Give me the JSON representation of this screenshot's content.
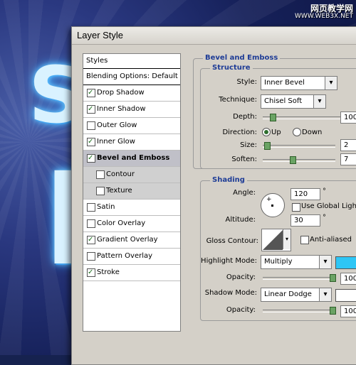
{
  "watermark": {
    "line1": "网页教学网",
    "line2": "WWW.WEB3X.NET"
  },
  "canvas": {
    "letter_top": "S",
    "letter_bottom": "I"
  },
  "dialog": {
    "title": "Layer Style"
  },
  "styles_panel": {
    "header": "Styles",
    "blending": "Blending Options: Default",
    "items": [
      {
        "label": "Drop Shadow",
        "checked": true
      },
      {
        "label": "Inner Shadow",
        "checked": true
      },
      {
        "label": "Outer Glow",
        "checked": false
      },
      {
        "label": "Inner Glow",
        "checked": true
      },
      {
        "label": "Bevel and Emboss",
        "checked": true,
        "selected": true
      },
      {
        "label": "Contour",
        "checked": false,
        "sub": true
      },
      {
        "label": "Texture",
        "checked": false,
        "sub": true
      },
      {
        "label": "Satin",
        "checked": false
      },
      {
        "label": "Color Overlay",
        "checked": false
      },
      {
        "label": "Gradient Overlay",
        "checked": true
      },
      {
        "label": "Pattern Overlay",
        "checked": false
      },
      {
        "label": "Stroke",
        "checked": true
      }
    ]
  },
  "bevel": {
    "section_title": "Bevel and Emboss",
    "structure_title": "Structure",
    "style_label": "Style:",
    "style_value": "Inner Bevel",
    "technique_label": "Technique:",
    "technique_value": "Chisel Soft",
    "depth_label": "Depth:",
    "depth_value": "100",
    "depth_fraction": 0.1,
    "direction_label": "Direction:",
    "dir_up": "Up",
    "dir_down": "Down",
    "direction_selected": "Up",
    "size_label": "Size:",
    "size_value": "2",
    "size_fraction": 0.02,
    "soften_label": "Soften:",
    "soften_value": "7",
    "soften_fraction": 0.4
  },
  "shading": {
    "title": "Shading",
    "angle_label": "Angle:",
    "angle_value": "120",
    "degree": "°",
    "global_light_label": "Use Global Light",
    "global_light_checked": false,
    "altitude_label": "Altitude:",
    "altitude_value": "30",
    "gloss_label": "Gloss Contour:",
    "antialiased_label": "Anti-aliased",
    "antialiased_checked": false,
    "highlight_mode_label": "Highlight Mode:",
    "highlight_mode_value": "Multiply",
    "highlight_color": "#2ec6f5",
    "opacity_label": "Opacity:",
    "highlight_opacity_value": "100",
    "highlight_opacity_fraction": 1.0,
    "shadow_mode_label": "Shadow Mode:",
    "shadow_mode_value": "Linear Dodge",
    "shadow_color": "#ffffff",
    "shadow_opacity_value": "100",
    "shadow_opacity_fraction": 1.0
  }
}
